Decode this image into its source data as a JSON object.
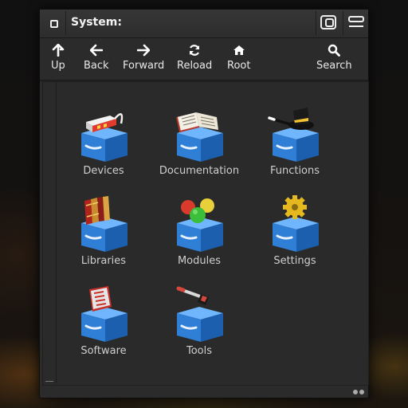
{
  "window": {
    "title": "System:"
  },
  "toolbar": {
    "items": [
      {
        "label": "Up",
        "icon": "arrow-up-icon"
      },
      {
        "label": "Back",
        "icon": "arrow-left-icon"
      },
      {
        "label": "Forward",
        "icon": "arrow-right-icon"
      },
      {
        "label": "Reload",
        "icon": "reload-icon"
      },
      {
        "label": "Root",
        "icon": "home-icon"
      },
      {
        "label": "Search",
        "icon": "search-icon"
      }
    ]
  },
  "drawers": [
    {
      "label": "Devices",
      "icon": "devices-drawer-icon"
    },
    {
      "label": "Documentation",
      "icon": "documentation-drawer-icon"
    },
    {
      "label": "Functions",
      "icon": "functions-drawer-icon"
    },
    {
      "label": "Libraries",
      "icon": "libraries-drawer-icon"
    },
    {
      "label": "Modules",
      "icon": "modules-drawer-icon"
    },
    {
      "label": "Settings",
      "icon": "settings-drawer-icon"
    },
    {
      "label": "Software",
      "icon": "software-drawer-icon"
    },
    {
      "label": "Tools",
      "icon": "tools-drawer-icon"
    }
  ],
  "colors": {
    "drawer_blue": "#2f7fd6",
    "window_bg": "#2b2b2b",
    "text": "#cfcfcf"
  }
}
